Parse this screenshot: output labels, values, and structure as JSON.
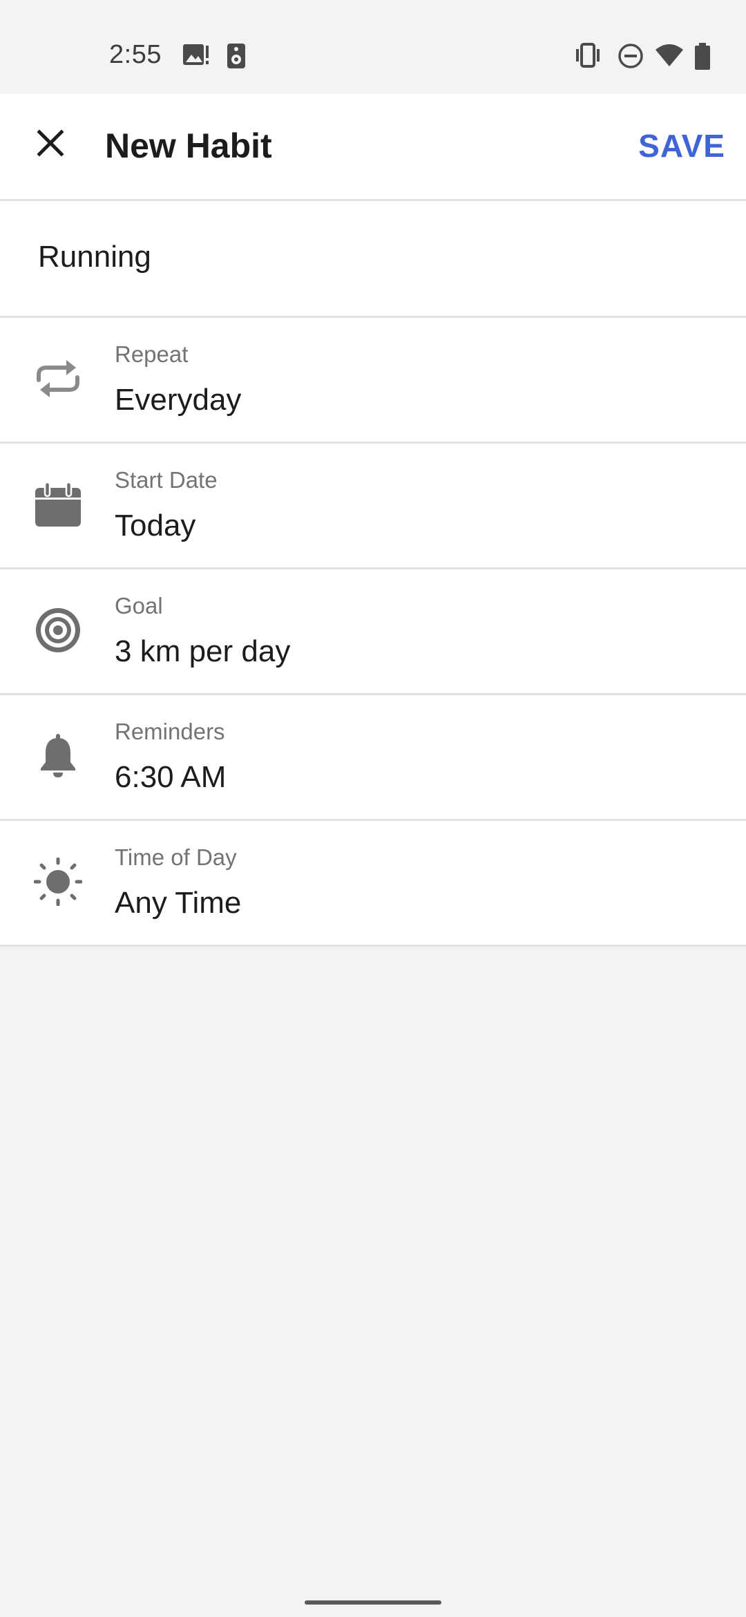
{
  "status_bar": {
    "time": "2:55",
    "left_icons": [
      "image-alert-icon",
      "speaker-icon"
    ],
    "right_icons": [
      "vibrate-icon",
      "do-not-disturb-icon",
      "wifi-icon",
      "battery-icon"
    ]
  },
  "app_bar": {
    "title": "New Habit",
    "save_label": "SAVE",
    "close_icon": "close-icon"
  },
  "habit_name": {
    "value": "Running"
  },
  "fields": [
    {
      "label": "Repeat",
      "value": "Everyday",
      "icon": "repeat-icon"
    },
    {
      "label": "Start Date",
      "value": "Today",
      "icon": "calendar-icon"
    },
    {
      "label": "Goal",
      "value": "3 km per day",
      "icon": "target-icon"
    },
    {
      "label": "Reminders",
      "value": "6:30 AM",
      "icon": "bell-icon"
    },
    {
      "label": "Time of Day",
      "value": "Any Time",
      "icon": "sun-icon"
    }
  ],
  "colors": {
    "accent": "#3f64d6",
    "icon_gray": "#6e6e6e",
    "background": "#f3f3f3"
  }
}
